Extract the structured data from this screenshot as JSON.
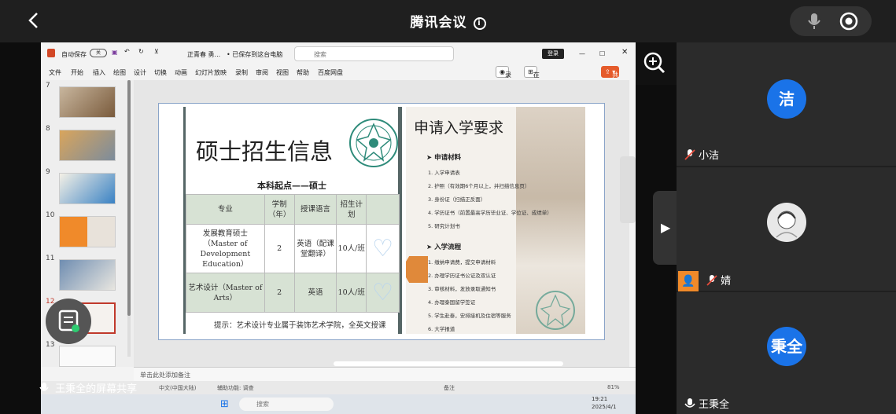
{
  "meeting": {
    "title": "腾讯会议",
    "share_label": "王秉全的屏幕共享"
  },
  "ppt": {
    "autosave": "自动保存",
    "author_doc": "正青春 勇...",
    "saved": "• 已保存到这台电脑",
    "search_placeholder": "搜索",
    "login": "登录",
    "menu": [
      "文件",
      "开始",
      "插入",
      "绘图",
      "设计",
      "切换",
      "动画",
      "幻灯片放映",
      "录制",
      "审阅",
      "视图",
      "帮助",
      "百度网盘"
    ],
    "record": "录制",
    "teams": "在 Teams 中展示",
    "share": "共享",
    "notes_placeholder": "单击此处添加备注",
    "status": {
      "lang": "中文(中国大陆)",
      "access": "辅助功能: 调查",
      "notes": "备注",
      "zoom": "81%"
    },
    "taskbar_search": "搜索",
    "clock": "19:21",
    "date": "2025/4/1",
    "thumb_numbers": [
      "7",
      "8",
      "9",
      "10",
      "11",
      "12",
      "13"
    ]
  },
  "slide": {
    "left_title": "硕士招生信息",
    "table_title": "本科起点——硕士",
    "headers": [
      "专业",
      "学制（年）",
      "授课语言",
      "招生计划"
    ],
    "rows": [
      [
        "发展教育硕士（Master of Development Education）",
        "2",
        "英语（配课堂翻译）",
        "10人/班"
      ],
      [
        "艺术设计（Master of Arts）",
        "2",
        "英语",
        "10人/班"
      ]
    ],
    "tip": "提示：艺术设计专业属于装饰艺术学院，全英文授课",
    "right_title": "申请入学要求",
    "section1": "申请材料",
    "materials": [
      "1. 入学申请表",
      "2. 护照（有效期6个月以上，并扫描信息页）",
      "3. 身份证（扫描正反面）",
      "4. 学历证书（前置最高学历毕业证、学位证、成绩单）",
      "5. 研究计划书"
    ],
    "section2": "入学流程",
    "process": [
      "1. 缴纳申请费，提交申请材料",
      "2. 办理学历证书公证及双认证",
      "3. 审核材料，发放录取通知书",
      "4. 办理泰国留学签证",
      "5. 学生赴泰，安排接机及住宿等服务",
      "6. 大学报道"
    ]
  },
  "participants": [
    {
      "avatar_text": "洁",
      "name": "小洁"
    },
    {
      "avatar_text": "",
      "name": "婧"
    },
    {
      "avatar_text": "秉全",
      "name": "王秉全"
    }
  ]
}
